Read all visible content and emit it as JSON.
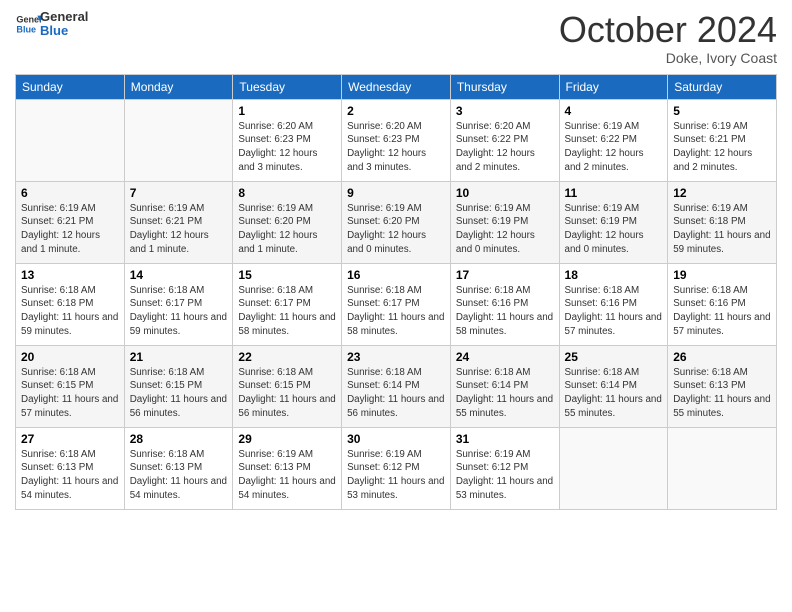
{
  "logo": {
    "text_general": "General",
    "text_blue": "Blue"
  },
  "header": {
    "month": "October 2024",
    "location": "Doke, Ivory Coast"
  },
  "weekdays": [
    "Sunday",
    "Monday",
    "Tuesday",
    "Wednesday",
    "Thursday",
    "Friday",
    "Saturday"
  ],
  "weeks": [
    [
      {
        "day": "",
        "info": ""
      },
      {
        "day": "",
        "info": ""
      },
      {
        "day": "1",
        "info": "Sunrise: 6:20 AM\nSunset: 6:23 PM\nDaylight: 12 hours and 3 minutes."
      },
      {
        "day": "2",
        "info": "Sunrise: 6:20 AM\nSunset: 6:23 PM\nDaylight: 12 hours and 3 minutes."
      },
      {
        "day": "3",
        "info": "Sunrise: 6:20 AM\nSunset: 6:22 PM\nDaylight: 12 hours and 2 minutes."
      },
      {
        "day": "4",
        "info": "Sunrise: 6:19 AM\nSunset: 6:22 PM\nDaylight: 12 hours and 2 minutes."
      },
      {
        "day": "5",
        "info": "Sunrise: 6:19 AM\nSunset: 6:21 PM\nDaylight: 12 hours and 2 minutes."
      }
    ],
    [
      {
        "day": "6",
        "info": "Sunrise: 6:19 AM\nSunset: 6:21 PM\nDaylight: 12 hours and 1 minute."
      },
      {
        "day": "7",
        "info": "Sunrise: 6:19 AM\nSunset: 6:21 PM\nDaylight: 12 hours and 1 minute."
      },
      {
        "day": "8",
        "info": "Sunrise: 6:19 AM\nSunset: 6:20 PM\nDaylight: 12 hours and 1 minute."
      },
      {
        "day": "9",
        "info": "Sunrise: 6:19 AM\nSunset: 6:20 PM\nDaylight: 12 hours and 0 minutes."
      },
      {
        "day": "10",
        "info": "Sunrise: 6:19 AM\nSunset: 6:19 PM\nDaylight: 12 hours and 0 minutes."
      },
      {
        "day": "11",
        "info": "Sunrise: 6:19 AM\nSunset: 6:19 PM\nDaylight: 12 hours and 0 minutes."
      },
      {
        "day": "12",
        "info": "Sunrise: 6:19 AM\nSunset: 6:18 PM\nDaylight: 11 hours and 59 minutes."
      }
    ],
    [
      {
        "day": "13",
        "info": "Sunrise: 6:18 AM\nSunset: 6:18 PM\nDaylight: 11 hours and 59 minutes."
      },
      {
        "day": "14",
        "info": "Sunrise: 6:18 AM\nSunset: 6:17 PM\nDaylight: 11 hours and 59 minutes."
      },
      {
        "day": "15",
        "info": "Sunrise: 6:18 AM\nSunset: 6:17 PM\nDaylight: 11 hours and 58 minutes."
      },
      {
        "day": "16",
        "info": "Sunrise: 6:18 AM\nSunset: 6:17 PM\nDaylight: 11 hours and 58 minutes."
      },
      {
        "day": "17",
        "info": "Sunrise: 6:18 AM\nSunset: 6:16 PM\nDaylight: 11 hours and 58 minutes."
      },
      {
        "day": "18",
        "info": "Sunrise: 6:18 AM\nSunset: 6:16 PM\nDaylight: 11 hours and 57 minutes."
      },
      {
        "day": "19",
        "info": "Sunrise: 6:18 AM\nSunset: 6:16 PM\nDaylight: 11 hours and 57 minutes."
      }
    ],
    [
      {
        "day": "20",
        "info": "Sunrise: 6:18 AM\nSunset: 6:15 PM\nDaylight: 11 hours and 57 minutes."
      },
      {
        "day": "21",
        "info": "Sunrise: 6:18 AM\nSunset: 6:15 PM\nDaylight: 11 hours and 56 minutes."
      },
      {
        "day": "22",
        "info": "Sunrise: 6:18 AM\nSunset: 6:15 PM\nDaylight: 11 hours and 56 minutes."
      },
      {
        "day": "23",
        "info": "Sunrise: 6:18 AM\nSunset: 6:14 PM\nDaylight: 11 hours and 56 minutes."
      },
      {
        "day": "24",
        "info": "Sunrise: 6:18 AM\nSunset: 6:14 PM\nDaylight: 11 hours and 55 minutes."
      },
      {
        "day": "25",
        "info": "Sunrise: 6:18 AM\nSunset: 6:14 PM\nDaylight: 11 hours and 55 minutes."
      },
      {
        "day": "26",
        "info": "Sunrise: 6:18 AM\nSunset: 6:13 PM\nDaylight: 11 hours and 55 minutes."
      }
    ],
    [
      {
        "day": "27",
        "info": "Sunrise: 6:18 AM\nSunset: 6:13 PM\nDaylight: 11 hours and 54 minutes."
      },
      {
        "day": "28",
        "info": "Sunrise: 6:18 AM\nSunset: 6:13 PM\nDaylight: 11 hours and 54 minutes."
      },
      {
        "day": "29",
        "info": "Sunrise: 6:19 AM\nSunset: 6:13 PM\nDaylight: 11 hours and 54 minutes."
      },
      {
        "day": "30",
        "info": "Sunrise: 6:19 AM\nSunset: 6:12 PM\nDaylight: 11 hours and 53 minutes."
      },
      {
        "day": "31",
        "info": "Sunrise: 6:19 AM\nSunset: 6:12 PM\nDaylight: 11 hours and 53 minutes."
      },
      {
        "day": "",
        "info": ""
      },
      {
        "day": "",
        "info": ""
      }
    ]
  ]
}
